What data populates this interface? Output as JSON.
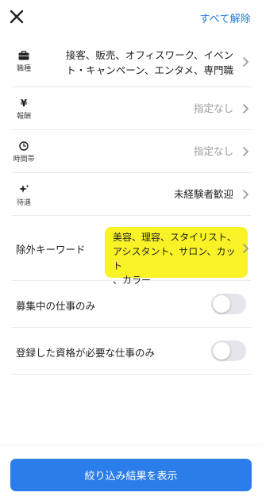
{
  "header": {
    "close_icon": "close-icon",
    "clear_all_label": "すべて解除"
  },
  "filters": {
    "job_type": {
      "icon": "briefcase-icon",
      "label": "職種",
      "value_line1": "接客、販売、オフィスワーク、イベン",
      "value_line2": "ト・キャンペーン、エンタメ、専門職"
    },
    "pay": {
      "icon": "yen-icon",
      "label": "報酬",
      "value": "指定なし"
    },
    "time": {
      "icon": "clock-icon",
      "label": "時間帯",
      "value": "指定なし"
    },
    "perks": {
      "icon": "sparkle-icon",
      "label": "待遇",
      "value": "未経験者歓迎"
    },
    "exclude_keywords": {
      "label": "除外キーワード",
      "line1": "美容、理容、スタイリスト、",
      "line2": "アシスタント、サロン、カット",
      "line3": "、カラー",
      "highlight_color": "#f9f226"
    },
    "hiring_only": {
      "label": "募集中の仕事のみ",
      "on": false
    },
    "qualified_only": {
      "label": "登録した資格が必要な仕事のみ",
      "on": false
    }
  },
  "footer": {
    "submit_label": "絞り込み結果を表示",
    "accent_color": "#2b7de9"
  }
}
